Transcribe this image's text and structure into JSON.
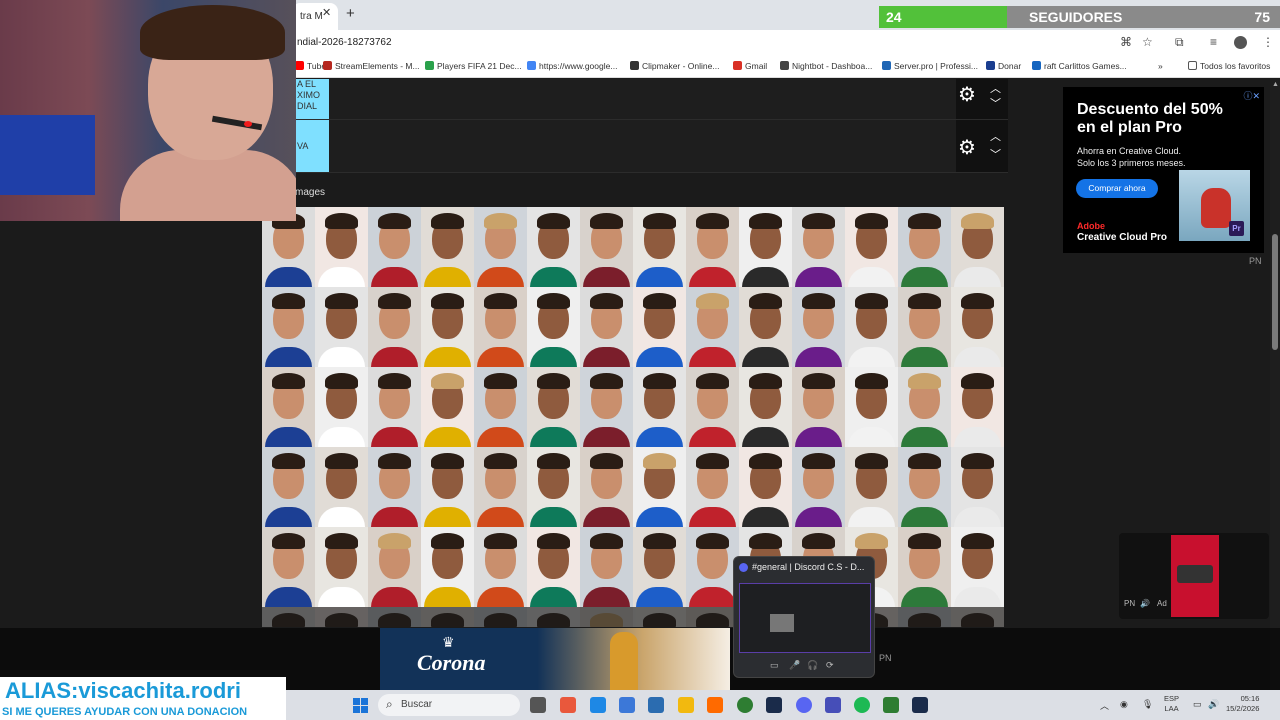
{
  "browser": {
    "tab_title": "tra M",
    "tab_close": "✕",
    "new_tab": "+",
    "url": "ndial-2026-18273762",
    "bookmarks": [
      {
        "label": "Tube",
        "color": "#ff0000"
      },
      {
        "label": "StreamElements - M...",
        "color": "#b5271f"
      },
      {
        "label": "Players FIFA 21 Dec...",
        "color": "#2aa14b"
      },
      {
        "label": "https://www.google...",
        "color": "#4285f4"
      },
      {
        "label": "Clipmaker - Online...",
        "color": "#333333"
      },
      {
        "label": "Gmail",
        "color": "#d93025"
      },
      {
        "label": "Nightbot - Dashboa...",
        "color": "#444444"
      },
      {
        "label": "Server.pro | Professi...",
        "color": "#1f66b5"
      },
      {
        "label": "Donar",
        "color": "#1a3d8f"
      },
      {
        "label": "raft Carlittos Games...",
        "color": "#1565c0"
      }
    ],
    "more_bookmarks": "»",
    "all_favorites": "Todos los favoritos"
  },
  "followers": {
    "current": "24",
    "label": "SEGUIDORES",
    "goal": "75",
    "progress": 0.32,
    "fill_color": "#52c13a"
  },
  "tiers": [
    {
      "label": "A EL\nXIMO\nDIAL"
    },
    {
      "label": "VA"
    }
  ],
  "images_label": "mages",
  "faces": {
    "skin": [
      "#e0b49a",
      "#c98f6d",
      "#d9a583",
      "#b87a56",
      "#e8c0a8",
      "#a96d4b",
      "#d5a07e",
      "#c28664",
      "#8f5b3e",
      "#dcae90",
      "#b98060",
      "#e6bba0",
      "#c49070",
      "#9b6446"
    ],
    "shirt": [
      "#c0222c",
      "#f2f2f2",
      "#1c3f94",
      "#e0b000",
      "#7b1e2b",
      "#2a2a2a",
      "#2d7a3a",
      "#ffffff",
      "#d14a1a",
      "#1d5ec9",
      "#6a1d8a",
      "#eaeaea",
      "#b01e2a",
      "#0e7a5a"
    ],
    "bg": [
      "#dcdcdc",
      "#e8e6e1",
      "#cfd4da",
      "#f1e7e3",
      "#d9d0c8",
      "#e4e4e4",
      "#ccd2d8",
      "#efefef",
      "#d8d2cc",
      "#e1dcd6"
    ]
  },
  "ad": {
    "title": "Descuento del 50% en el plan Pro",
    "body": "Ahorra en Creative Cloud. Solo los 3 primeros meses.",
    "cta": "Comprar ahora",
    "brand_line1": "Adobe",
    "brand_line2": "Creative Cloud Pro",
    "badge": "Pr",
    "info": "ⓘ✕",
    "pn": "PN"
  },
  "bottom_ad": {
    "brand": "Corona",
    "crown": "♛",
    "pn": "PN"
  },
  "discord": {
    "title": "#general | Discord C.S - D...",
    "buttons": [
      "▭",
      "🎤",
      "🎧",
      "⟳"
    ]
  },
  "mini_ad": {
    "pn": "PN",
    "sound": "🔊",
    "ad_label": "Ad"
  },
  "overlay": {
    "alias": "ALIAS:viscachita.rodri",
    "donation": "SI ME QUERES AYUDAR CON UNA DONACION"
  },
  "taskbar": {
    "search_placeholder": "Buscar",
    "lang_line1": "ESP",
    "lang_line2": "LAA",
    "time": "05:16",
    "date": "15/2/2026",
    "app_colors": [
      "#555555",
      "#e9583c",
      "#1e88e5",
      "#3c78d8",
      "#2b6cb0",
      "#f2b90f",
      "#ff6a00",
      "#2e7d32",
      "#1a2b4a",
      "#5865f2",
      "#464eb8",
      "#1db954",
      "#2e7d32",
      "#1a2b4a"
    ]
  },
  "cam": {
    "description_hidden": ""
  }
}
